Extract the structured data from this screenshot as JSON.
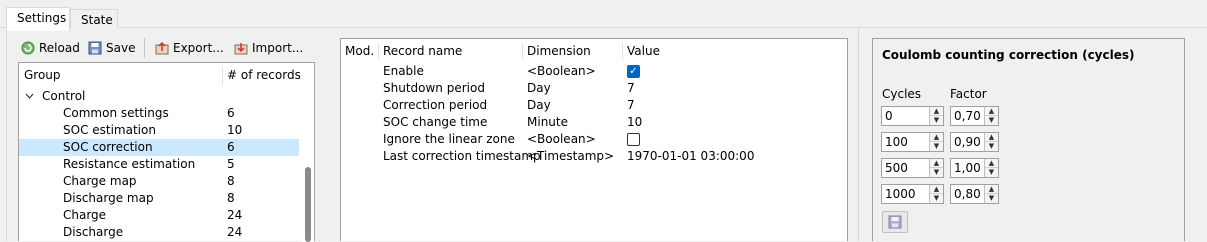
{
  "tabs": [
    {
      "label": "Settings",
      "active": true
    },
    {
      "label": "State",
      "active": false
    }
  ],
  "toolbar": {
    "reload_label": "Reload",
    "save_label": "Save",
    "export_label": "Export...",
    "import_label": "Import..."
  },
  "tree": {
    "col_group": "Group",
    "col_records": "# of records",
    "root_label": "Control",
    "items": [
      {
        "name": "Common settings",
        "count": "6"
      },
      {
        "name": "SOC estimation",
        "count": "10"
      },
      {
        "name": "SOC correction",
        "count": "6",
        "selected": true
      },
      {
        "name": "Resistance estimation",
        "count": "5"
      },
      {
        "name": "Charge map",
        "count": "8"
      },
      {
        "name": "Discharge map",
        "count": "8"
      },
      {
        "name": "Charge",
        "count": "24"
      },
      {
        "name": "Discharge",
        "count": "24"
      }
    ]
  },
  "records": {
    "col_mod": "Mod.",
    "col_name": "Record name",
    "col_dim": "Dimension",
    "col_value": "Value",
    "rows": [
      {
        "name": "Enable",
        "dim": "<Boolean>",
        "value": "",
        "checkbox": true,
        "checked": true
      },
      {
        "name": "Shutdown period",
        "dim": "Day",
        "value": "7"
      },
      {
        "name": "Correction period",
        "dim": "Day",
        "value": "7"
      },
      {
        "name": "SOC change time",
        "dim": "Minute",
        "value": "10"
      },
      {
        "name": "Ignore the linear zone",
        "dim": "<Boolean>",
        "value": "",
        "checkbox": true,
        "checked": false
      },
      {
        "name": "Last correction timestamp",
        "dim": "<Timestamp>",
        "value": "1970-01-01 03:00:00"
      }
    ]
  },
  "coulomb": {
    "title": "Coulomb counting correction (cycles)",
    "cycles_label": "Cycles",
    "factor_label": "Factor",
    "rows": [
      {
        "cycles": "0",
        "factor": "0,70"
      },
      {
        "cycles": "100",
        "factor": "0,90"
      },
      {
        "cycles": "500",
        "factor": "1,00"
      },
      {
        "cycles": "1000",
        "factor": "0,80"
      }
    ]
  },
  "colors": {
    "selection": "#cce8ff",
    "accent": "#0067c0"
  }
}
